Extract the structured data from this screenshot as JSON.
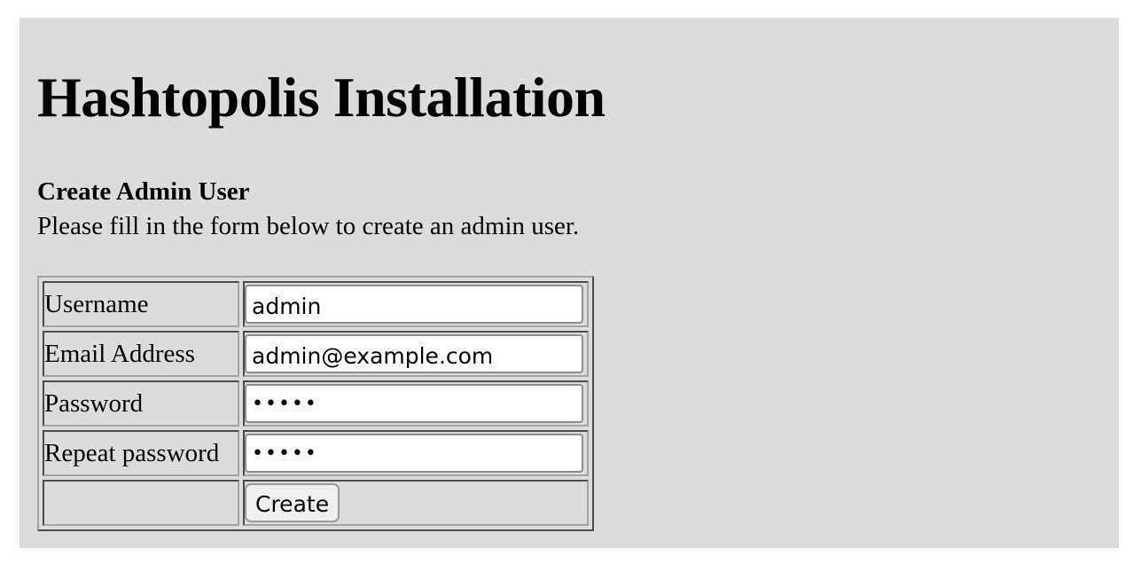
{
  "page": {
    "title": "Hashtopolis Installation"
  },
  "section": {
    "title": "Create Admin User",
    "description": "Please fill in the form below to create an admin user."
  },
  "form": {
    "fields": [
      {
        "label": "Username",
        "type": "text",
        "value": "admin"
      },
      {
        "label": "Email Address",
        "type": "text",
        "value": "admin@example.com"
      },
      {
        "label": "Password",
        "type": "password",
        "value": "admin"
      },
      {
        "label": "Repeat password",
        "type": "password",
        "value": "admin"
      }
    ],
    "submit_label": "Create"
  }
}
